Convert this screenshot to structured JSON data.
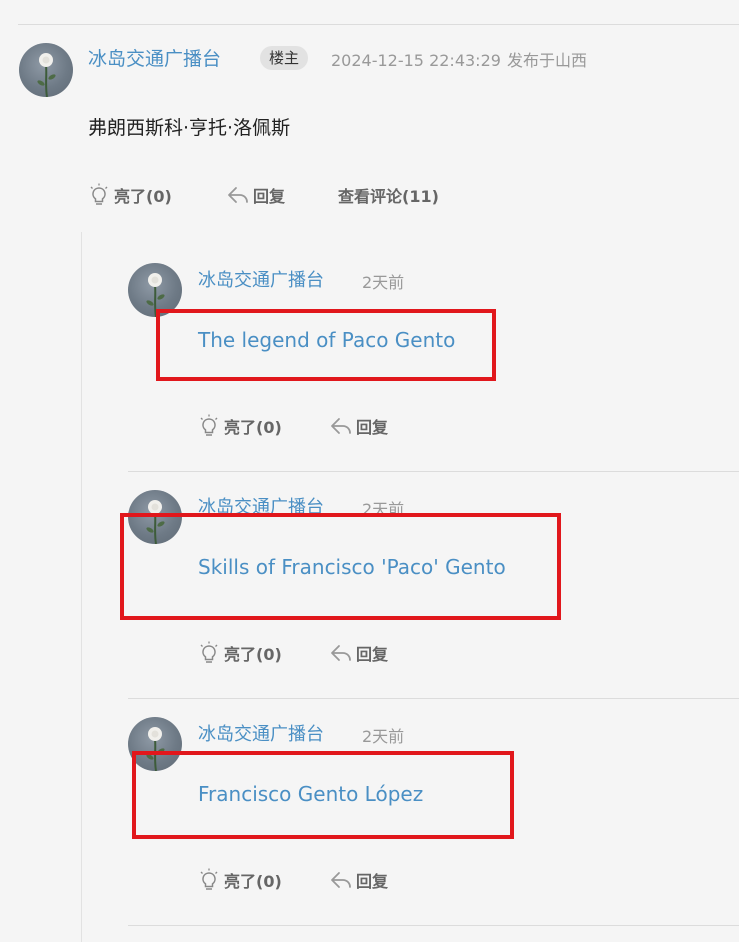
{
  "post": {
    "username": "冰岛交通广播台",
    "op_badge": "楼主",
    "timestamp": "2024-12-15 22:43:29",
    "location": "发布于山西",
    "content": "弗朗西斯科·亨托·洛佩斯",
    "actions": {
      "like": "亮了(0)",
      "reply": "回复",
      "view_comments": "查看评论(11)"
    }
  },
  "replies": [
    {
      "username": "冰岛交通广播台",
      "time": "2天前",
      "content": "The legend of Paco Gento",
      "like": "亮了(0)",
      "reply": "回复"
    },
    {
      "username": "冰岛交通广播台",
      "time": "2天前",
      "content": "Skills of Francisco 'Paco' Gento",
      "like": "亮了(0)",
      "reply": "回复"
    },
    {
      "username": "冰岛交通广播台",
      "time": "2天前",
      "content": "Francisco Gento López",
      "like": "亮了(0)",
      "reply": "回复"
    }
  ],
  "colors": {
    "link": "#4a8fc4",
    "highlight_box": "#e1171c",
    "background": "#f5f5f5"
  },
  "icons": {
    "like": "lightbulb-icon",
    "reply": "reply-arrow-icon"
  }
}
